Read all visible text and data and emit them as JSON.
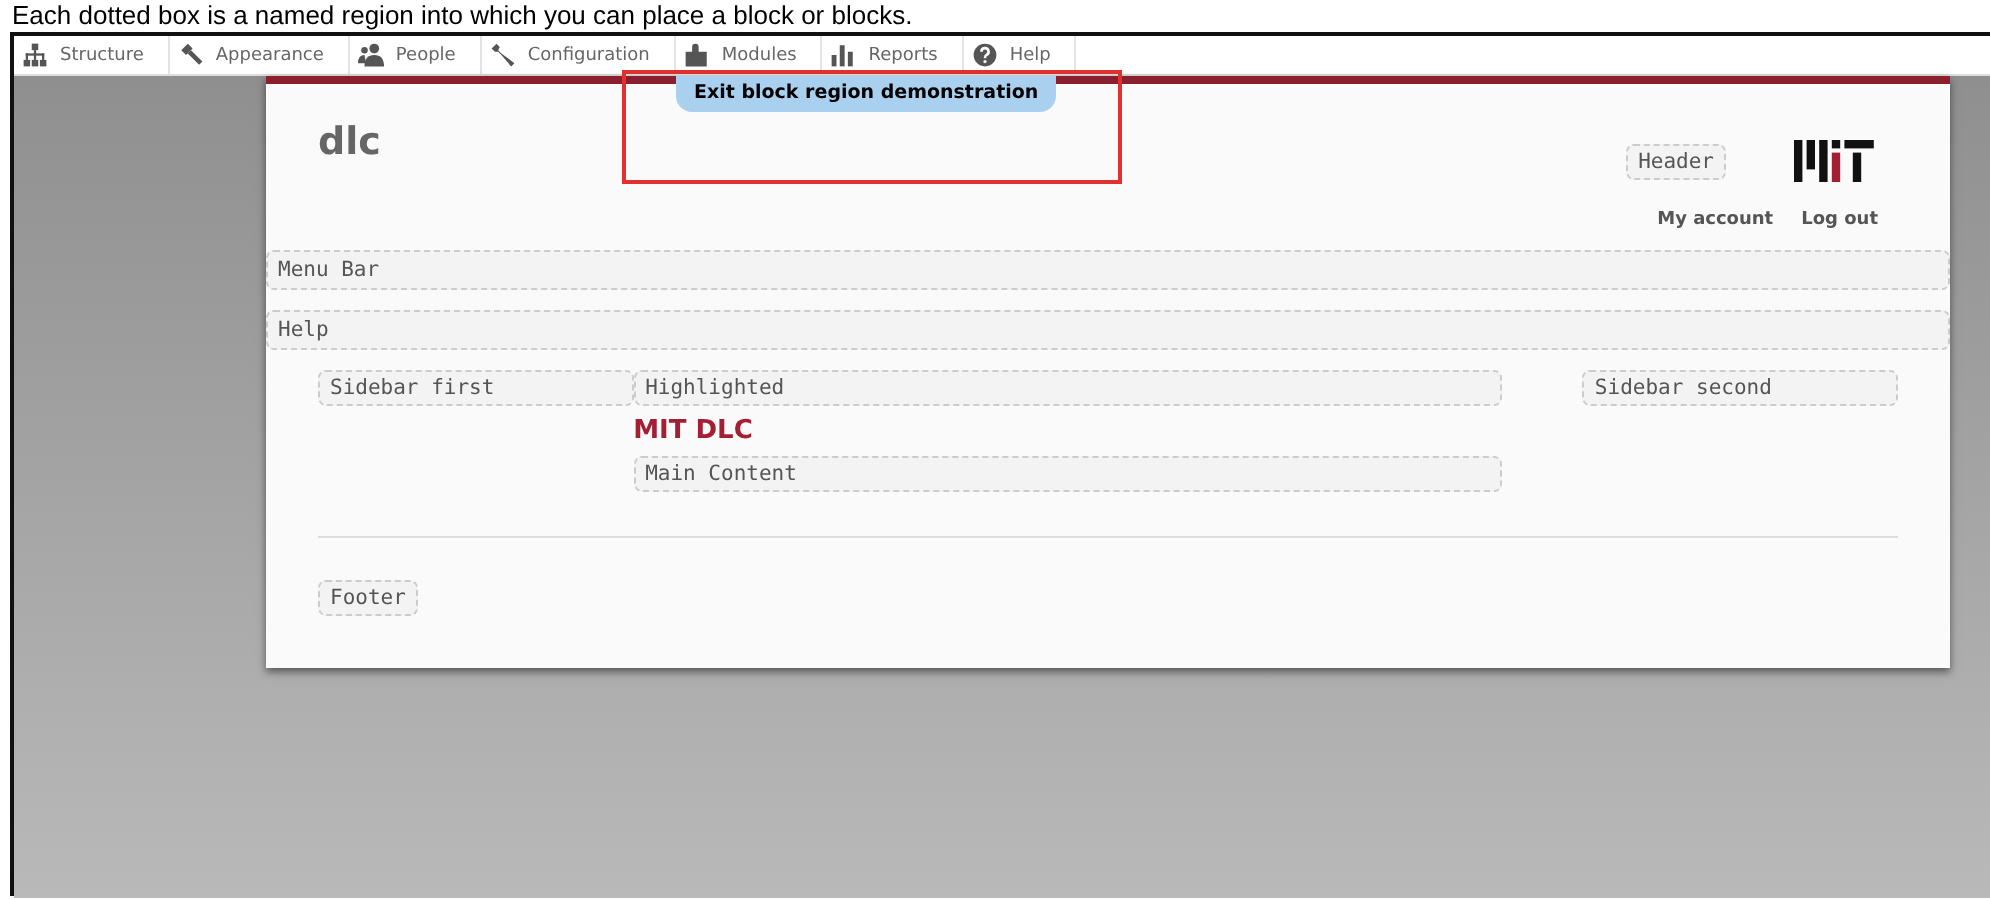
{
  "caption": "Each dotted box is a named region into which you can place a block or blocks.",
  "toolbar": [
    {
      "kind": "structure",
      "label": "Structure"
    },
    {
      "kind": "appearance",
      "label": "Appearance"
    },
    {
      "kind": "people",
      "label": "People"
    },
    {
      "kind": "configuration",
      "label": "Configuration"
    },
    {
      "kind": "modules",
      "label": "Modules"
    },
    {
      "kind": "reports",
      "label": "Reports"
    },
    {
      "kind": "help",
      "label": "Help"
    }
  ],
  "exit_button": "Exit block region demonstration",
  "site_name": "dlc",
  "header_region": "Header",
  "user_links": [
    "My account",
    "Log out"
  ],
  "full_regions": [
    "Menu Bar",
    "Help"
  ],
  "sidebar_first": "Sidebar first",
  "highlighted": "Highlighted",
  "page_title": "MIT DLC",
  "main_content": "Main Content",
  "sidebar_second": "Sidebar second",
  "footer": "Footer"
}
